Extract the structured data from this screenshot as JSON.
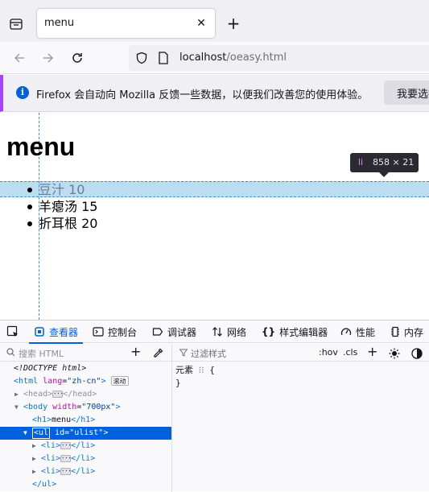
{
  "browser": {
    "tab": {
      "title": "menu",
      "close_glyph": "✕"
    },
    "new_tab_glyph": "+",
    "url": {
      "host": "localhost",
      "path": "/oeasy.html"
    }
  },
  "notification": {
    "message": "Firefox 会自动向 Mozilla 反馈一些数据，以便我们改善您的使用体验。",
    "button": "我要选择"
  },
  "page": {
    "heading": "menu",
    "items": [
      "豆汁 10",
      "羊瘪汤 15",
      "折耳根 20"
    ],
    "tooltip": {
      "tag": "li",
      "size": "858 × 21"
    }
  },
  "devtools": {
    "tabs": [
      {
        "label": "查看器",
        "icon": "inspector-icon"
      },
      {
        "label": "控制台",
        "icon": "console-icon"
      },
      {
        "label": "调试器",
        "icon": "debugger-icon"
      },
      {
        "label": "网络",
        "icon": "network-icon"
      },
      {
        "label": "样式编辑器",
        "icon": "style-editor-icon"
      },
      {
        "label": "性能",
        "icon": "performance-icon"
      },
      {
        "label": "内存",
        "icon": "memory-icon"
      }
    ],
    "search_placeholder": "搜索 HTML",
    "filter_placeholder": "过滤样式",
    "hov": ":hov",
    "cls": ".cls",
    "markup": {
      "doctype": "<!DOCTYPE html>",
      "html_tag": "html",
      "html_attr": "lang",
      "html_val": "\"zh-cn\"",
      "scroll_badge": "滚动",
      "head_tag": "head",
      "body_tag": "body",
      "body_attr": "width",
      "body_val": "\"700px\"",
      "h1_text": "menu",
      "ul_tag": "ul",
      "ul_attr": "id",
      "ul_val": "\"ulist\"",
      "li_tag": "li",
      "close_ul": "</ul>"
    },
    "rules": {
      "element_label": "元素",
      "open": "{",
      "close": "}"
    }
  },
  "colors": {
    "accent": "#0060df",
    "highlight": "#a0cdeb"
  }
}
